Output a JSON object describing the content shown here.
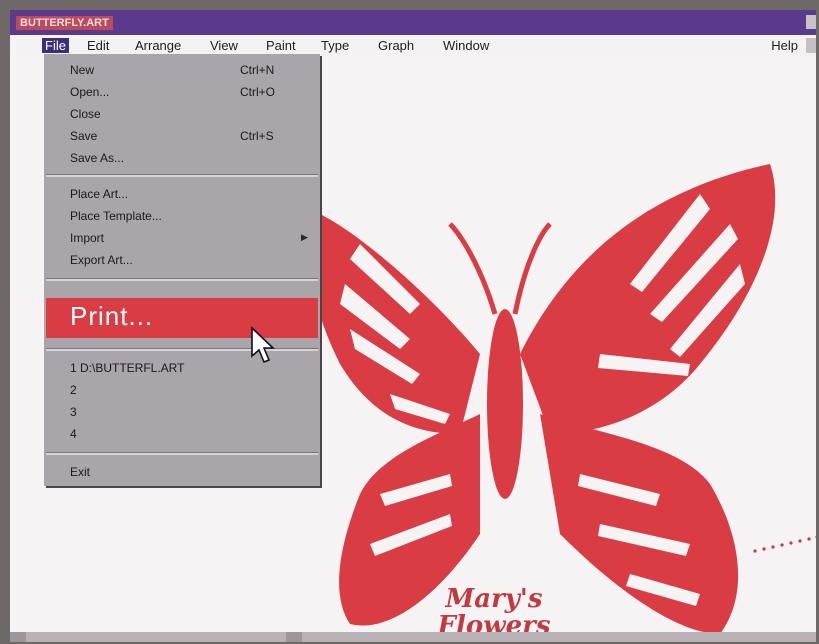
{
  "title": {
    "text": "BUTTERFLY.ART"
  },
  "menubar": {
    "items": [
      "File",
      "Edit",
      "Arrange",
      "View",
      "Paint",
      "Type",
      "Graph",
      "Window"
    ],
    "help": "Help"
  },
  "file_menu": {
    "new": {
      "label": "New",
      "shortcut": "Ctrl+N"
    },
    "open": {
      "label": "Open...",
      "shortcut": "Ctrl+O"
    },
    "close": {
      "label": "Close"
    },
    "save": {
      "label": "Save",
      "shortcut": "Ctrl+S"
    },
    "save_as": {
      "label": "Save As..."
    },
    "place_art": {
      "label": "Place Art..."
    },
    "place_template": {
      "label": "Place Template..."
    },
    "import": {
      "label": "Import"
    },
    "export_art": {
      "label": "Export Art..."
    },
    "print": {
      "label": "Print..."
    },
    "recent": [
      "1 D:\\BUTTERFL.ART",
      "2",
      "3",
      "4"
    ],
    "exit": {
      "label": "Exit"
    }
  },
  "artwork": {
    "line1": "Mary's",
    "line2": "Flowers"
  },
  "colors": {
    "accent": "#d93c43",
    "title_bar": "#5a3a8c",
    "menu_highlight": "#3a2f7a",
    "butterfly": "#d93c43"
  },
  "icons": [
    "submenu-arrow-icon",
    "mouse-pointer-icon"
  ]
}
